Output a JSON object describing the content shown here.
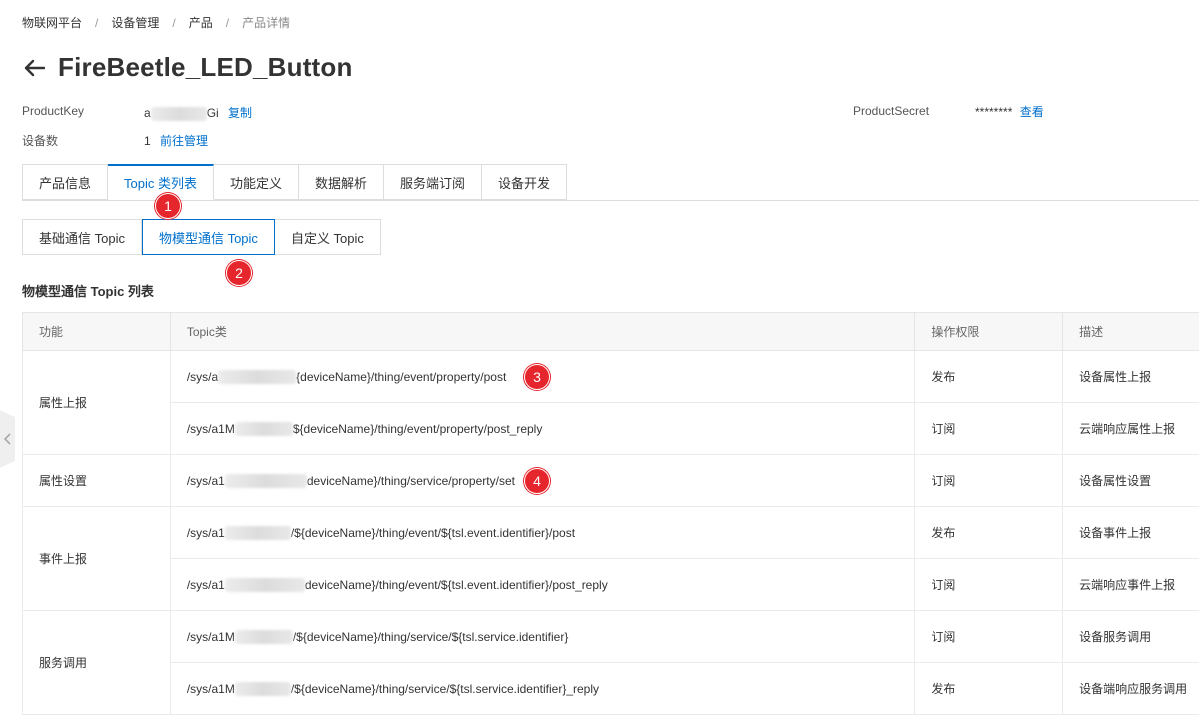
{
  "breadcrumb": {
    "items": [
      "物联网平台",
      "设备管理",
      "产品"
    ],
    "current": "产品详情",
    "separator": "/"
  },
  "page": {
    "title": "FireBeetle_LED_Button"
  },
  "meta": {
    "product_key_label": "ProductKey",
    "product_key_prefix": "a",
    "product_key_suffix": "Gi",
    "copy_link": "复制",
    "device_count_label": "设备数",
    "device_count": "1",
    "manage_link": "前往管理",
    "product_secret_label": "ProductSecret",
    "product_secret_value": "********",
    "view_link": "查看"
  },
  "tabs": [
    {
      "label": "产品信息"
    },
    {
      "label": "Topic 类列表",
      "active": true
    },
    {
      "label": "功能定义"
    },
    {
      "label": "数据解析"
    },
    {
      "label": "服务端订阅"
    },
    {
      "label": "设备开发"
    }
  ],
  "subtabs": [
    {
      "label": "基础通信 Topic"
    },
    {
      "label": "物模型通信 Topic",
      "active": true
    },
    {
      "label": "自定义 Topic"
    }
  ],
  "badges": [
    "1",
    "2",
    "3",
    "4"
  ],
  "section_title": "物模型通信 Topic 列表",
  "table": {
    "headers": [
      "功能",
      "Topic类",
      "操作权限",
      "描述"
    ],
    "groups": [
      {
        "function": "属性上报",
        "rows": [
          {
            "prefix": "/sys/a",
            "suffix": "{deviceName}/thing/event/property/post",
            "perm": "发布",
            "desc": "设备属性上报"
          },
          {
            "prefix": "/sys/a1M",
            "suffix": "${deviceName}/thing/event/property/post_reply",
            "perm": "订阅",
            "desc": "云端响应属性上报"
          }
        ]
      },
      {
        "function": "属性设置",
        "rows": [
          {
            "prefix": "/sys/a1",
            "suffix": "deviceName}/thing/service/property/set",
            "perm": "订阅",
            "desc": "设备属性设置"
          }
        ]
      },
      {
        "function": "事件上报",
        "rows": [
          {
            "prefix": "/sys/a1",
            "suffix": "/${deviceName}/thing/event/${tsl.event.identifier}/post",
            "perm": "发布",
            "desc": "设备事件上报"
          },
          {
            "prefix": "/sys/a1",
            "suffix": "deviceName}/thing/event/${tsl.event.identifier}/post_reply",
            "perm": "订阅",
            "desc": "云端响应事件上报"
          }
        ]
      },
      {
        "function": "服务调用",
        "rows": [
          {
            "prefix": "/sys/a1M",
            "suffix": "/${deviceName}/thing/service/${tsl.service.identifier}",
            "perm": "订阅",
            "desc": "设备服务调用"
          },
          {
            "prefix": "/sys/a1M",
            "suffix": "/${deviceName}/thing/service/${tsl.service.identifier}_reply",
            "perm": "发布",
            "desc": "设备端响应服务调用"
          }
        ]
      }
    ]
  },
  "icons": {
    "back": "arrow-left-icon",
    "side_handle": "chevron-left-icon"
  }
}
